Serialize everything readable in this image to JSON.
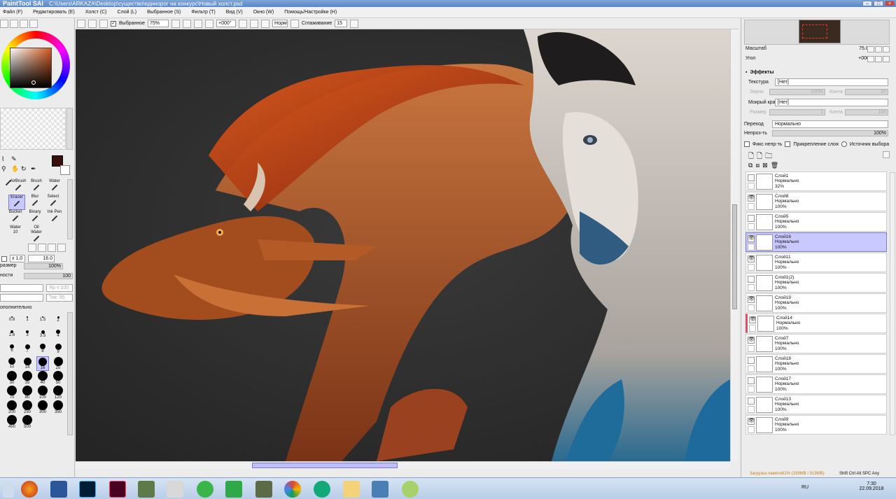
{
  "app": {
    "name": "PaintTool SAI",
    "path": "C:\\Users\\ARKAZA\\Desktop\\существо\\единорог на конкурс\\Новый холст.psd"
  },
  "menu": [
    "Файл (F)",
    "Редактировать (E)",
    "Холст (C)",
    "Слой (L)",
    "Выбранное (S)",
    "Фильтр (T)",
    "Вид (V)",
    "Окно (W)",
    "Помощь/Настройки (H)"
  ],
  "toolbar": {
    "selection_label": "Выбранное",
    "zoom": "75%",
    "angle": "+000°",
    "mode": "Норм",
    "smoothing_label": "Сглаживание",
    "smoothing_value": "15"
  },
  "tools": {
    "row1": [
      "AirBrush",
      "Brush",
      "Water"
    ],
    "row2": [
      "Eraser",
      "Blur",
      "Select"
    ],
    "row3": [
      "Bucket",
      "Binary",
      "Ink Pen"
    ],
    "row4": [
      "Water",
      "Oil Water"
    ],
    "row4_value": "10"
  },
  "brush_settings": {
    "size_mult": "x 1.0",
    "size": "16.0",
    "min_size_label": "размер",
    "min_size": "100%",
    "density_label": "ности",
    "density": "100",
    "advanced": "ополнительно",
    "disabled1": "Яр-т:100",
    "disabled2": "Тек: 95"
  },
  "brush_sizes": [
    "0.8",
    "1",
    "1.5",
    "2",
    "2.6",
    "3",
    "3.5",
    "4",
    "6",
    "7",
    "8",
    "9",
    "12",
    "14",
    "16",
    "20",
    "30",
    "35",
    "40",
    "50",
    "70",
    "80",
    "100",
    "120",
    "200",
    "250",
    "300",
    "350",
    "450",
    "500"
  ],
  "navigator": {
    "scale_label": "Масштаб",
    "scale": "75.0%",
    "angle_label": "Угол",
    "angle": "+000Я"
  },
  "effects": {
    "header": "Эффекты",
    "texture_label": "Текстура",
    "texture_value": "[Нет]",
    "grain_label": "Зерно",
    "grain_value": "100%",
    "contrast_label": "Конта",
    "contrast_value": "20",
    "wet_edge_label": "Мокрый край",
    "wet_edge_value": "[Нет]",
    "size_label": "Размер",
    "size_value": "1",
    "strength_label": "Конта",
    "strength_value": "100"
  },
  "blend": {
    "mode_label": "Переход",
    "mode_value": "Нормально",
    "opacity_label": "Непроз-ть",
    "opacity_value": "100%",
    "opacity_fraction": 1.0
  },
  "layer_options": {
    "fix_opacity": "Фикс непр-ть",
    "clip": "Прикрепление слоя",
    "source": "Источник выбора"
  },
  "layers": [
    {
      "name": "Слой1",
      "mode": "Нормально",
      "opacity": "32%",
      "visible": false
    },
    {
      "name": "Слой8",
      "mode": "Нормально",
      "opacity": "100%",
      "visible": true
    },
    {
      "name": "Слой5",
      "mode": "Нормально",
      "opacity": "100%",
      "visible": false
    },
    {
      "name": "Слой16",
      "mode": "Нормально",
      "opacity": "100%",
      "visible": true,
      "selected": true
    },
    {
      "name": "Слой11",
      "mode": "Нормально",
      "opacity": "100%",
      "visible": true
    },
    {
      "name": "Слой1(2)",
      "mode": "Нормально",
      "opacity": "100%",
      "visible": false
    },
    {
      "name": "Слой19",
      "mode": "Нормально",
      "opacity": "100%",
      "visible": true
    },
    {
      "name": "Слой14",
      "mode": "Нормально",
      "opacity": "100%",
      "visible": true,
      "flag": true
    },
    {
      "name": "Слой7",
      "mode": "Нормально",
      "opacity": "100%",
      "visible": true
    },
    {
      "name": "Слой18",
      "mode": "Нормально",
      "opacity": "100%",
      "visible": false
    },
    {
      "name": "Слой17",
      "mode": "Нормально",
      "opacity": "100%",
      "visible": false
    },
    {
      "name": "Слой13",
      "mode": "Нормально",
      "opacity": "100%",
      "visible": false
    },
    {
      "name": "Слой9",
      "mode": "Нормально",
      "opacity": "100%",
      "visible": true
    }
  ],
  "status": {
    "memory": "Загрузка памяти82% (339MB / 919MB)",
    "keys": "Shift Ctrl Alt SPC Any"
  },
  "taskbar": {
    "lang": "RU",
    "time": "7:30",
    "date": "22.09.2018"
  },
  "colors": {
    "primary": "#3a0e0a",
    "selected_layer": "#c9c9ff",
    "canvas_bg": "#2f2f2f",
    "flag": "#e04b6b"
  }
}
